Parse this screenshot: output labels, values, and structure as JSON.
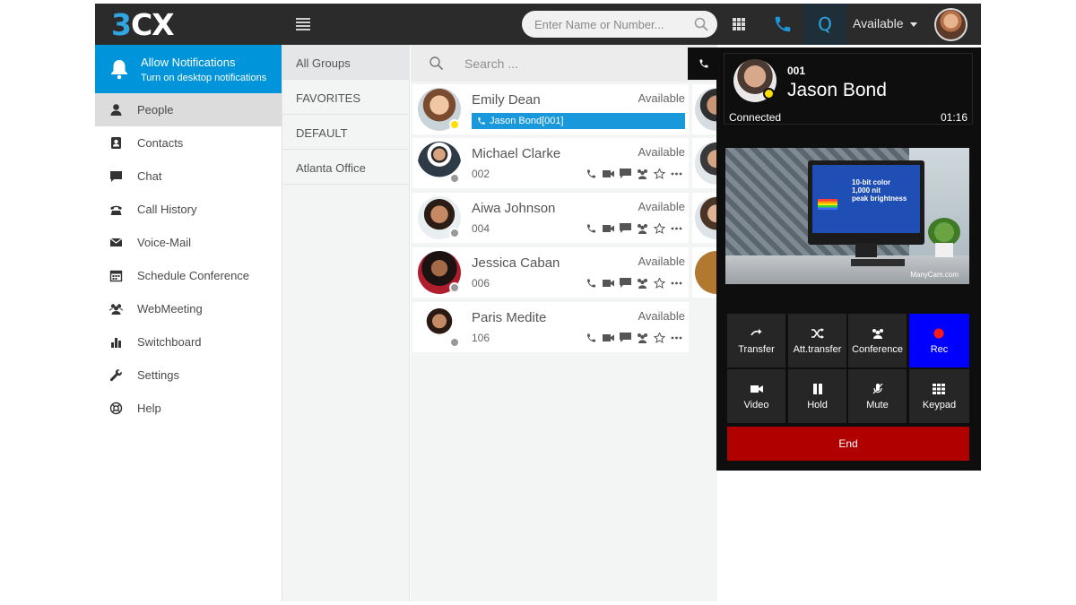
{
  "topbar": {
    "logo_3": "3",
    "logo_cx": "CX",
    "search_placeholder": "Enter Name or Number...",
    "q_label": "Q",
    "status": "Available"
  },
  "notification": {
    "title": "Allow Notifications",
    "subtitle": "Turn on desktop notifications"
  },
  "nav": [
    {
      "label": "People",
      "icon": "person-icon"
    },
    {
      "label": "Contacts",
      "icon": "contacts-icon"
    },
    {
      "label": "Chat",
      "icon": "chat-icon"
    },
    {
      "label": "Call History",
      "icon": "call-history-icon"
    },
    {
      "label": "Voice-Mail",
      "icon": "voicemail-icon"
    },
    {
      "label": "Schedule Conference",
      "icon": "calendar-icon"
    },
    {
      "label": "WebMeeting",
      "icon": "group-icon"
    },
    {
      "label": "Switchboard",
      "icon": "bar-chart-icon"
    },
    {
      "label": "Settings",
      "icon": "wrench-icon"
    },
    {
      "label": "Help",
      "icon": "lifebuoy-icon"
    }
  ],
  "groups": [
    "All Groups",
    "FAVORITES",
    "DEFAULT",
    "Atlanta Office"
  ],
  "contacts_search_placeholder": "Search ...",
  "contacts": [
    {
      "name": "Emily Dean",
      "ext": "",
      "status": "Available",
      "presence": "busy",
      "active_call": "Jason Bond[001]"
    },
    {
      "name": "Michael Clarke",
      "ext": "002",
      "status": "Available",
      "presence": "offline"
    },
    {
      "name": "Aiwa Johnson",
      "ext": "004",
      "status": "Available",
      "presence": "offline"
    },
    {
      "name": "Jessica Caban",
      "ext": "006",
      "status": "Available",
      "presence": "offline"
    },
    {
      "name": "Paris Medite",
      "ext": "106",
      "status": "Available",
      "presence": "offline"
    }
  ],
  "call": {
    "ext": "001",
    "name": "Jason Bond",
    "state": "Connected",
    "duration": "01:16",
    "video_screen_text": "10-bit color\n1,000 nit\npeak brightness",
    "video_watermark": "ManyCam.com",
    "buttons": [
      {
        "label": "Transfer",
        "icon": "transfer-icon"
      },
      {
        "label": "Att.transfer",
        "icon": "shuffle-icon"
      },
      {
        "label": "Conference",
        "icon": "conference-icon"
      },
      {
        "label": "Rec",
        "icon": "record-icon"
      },
      {
        "label": "Video",
        "icon": "video-icon"
      },
      {
        "label": "Hold",
        "icon": "pause-icon"
      },
      {
        "label": "Mute",
        "icon": "mic-mute-icon"
      },
      {
        "label": "Keypad",
        "icon": "keypad-icon"
      }
    ],
    "end_label": "End"
  },
  "colors": {
    "topbar": "#2b2b2b",
    "accent": "#0095da",
    "rec": "#0000ff",
    "end": "#b00000",
    "presence_busy": "#ffe000"
  }
}
